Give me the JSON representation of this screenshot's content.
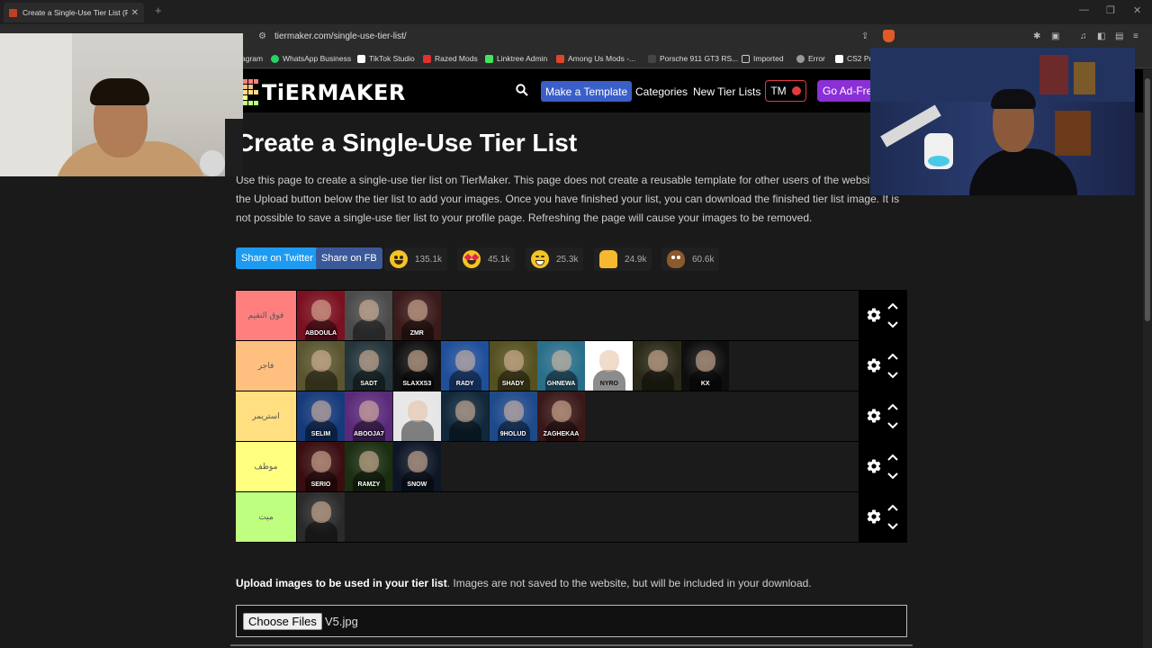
{
  "browser": {
    "tab_title": "Create a Single-Use Tier List (Pr",
    "tab_close": "✕",
    "new_tab": "+",
    "url": "tiermaker.com/single-use-tier-list/",
    "window_controls": [
      "—",
      "❐",
      "✕"
    ],
    "bookmarks": [
      {
        "label": "agram",
        "color": "#c13584"
      },
      {
        "label": "WhatsApp Business",
        "color": "#25d366"
      },
      {
        "label": "TikTok Studio",
        "color": "#ffffff"
      },
      {
        "label": "Razed Mods",
        "color": "#e03030"
      },
      {
        "label": "Linktree Admin",
        "color": "#43e55e"
      },
      {
        "label": "Among Us Mods -...",
        "color": "#e0452a"
      },
      {
        "label": "Porsche 911 GT3 RS...",
        "color": "#444444"
      },
      {
        "label": "Imported",
        "color": "#cccccc"
      },
      {
        "label": "Error",
        "color": "#999999"
      },
      {
        "label": "CS2 Pr",
        "color": "#ffffff"
      }
    ]
  },
  "nav": {
    "logo": "TiERMAKER",
    "make_template": "Make a Template",
    "categories": "Categories",
    "new_tier_lists": "New Tier Lists",
    "tm": "TM",
    "ad_free": "Go Ad-Free"
  },
  "page": {
    "title": "Create a Single-Use Tier List",
    "intro": "Use this page to create a single-use tier list on TierMaker. This page does not create a reusable template for other users of the website. Use the Upload button below the tier list to add your images. Once you have finished your list, you can download the finished tier list image. It is not possible to save a single-use tier list to your profile page. Refreshing the page will cause your images to be removed.",
    "share_twitter": "Share on Twitter",
    "share_fb": "Share on FB",
    "reactions": [
      {
        "icon": "smile-emoji-icon",
        "count": "135.1k"
      },
      {
        "icon": "heart-eyes-emoji-icon",
        "count": "45.1k"
      },
      {
        "icon": "laugh-emoji-icon",
        "count": "25.3k"
      },
      {
        "icon": "raised-hands-emoji-icon",
        "count": "24.9k"
      },
      {
        "icon": "poop-emoji-icon",
        "count": "60.6k"
      }
    ],
    "upload_bold": "Upload images to be used in your tier list",
    "upload_rest": ". Images are not saved to the website, but will be included in your download.",
    "choose_files": "Choose Files",
    "file_name": "V5.jpg"
  },
  "tiers": [
    {
      "label": "فوق التقيم",
      "color": "#ff7f7f",
      "items": [
        {
          "bg": "#7a1020",
          "tag": "ABDOULA"
        },
        {
          "bg": "#4a4a4a",
          "tag": ""
        },
        {
          "bg": "#3a1a1a",
          "tag": "ZMR"
        }
      ]
    },
    {
      "label": "فاجر",
      "color": "#ffbf7f",
      "items": [
        {
          "bg": "#5a5530",
          "tag": ""
        },
        {
          "bg": "#23343a",
          "tag": "SADT"
        },
        {
          "bg": "#101010",
          "tag": "SLAXXS3"
        },
        {
          "bg": "#1f4f9a",
          "tag": "RADY"
        },
        {
          "bg": "#55501f",
          "tag": "SHADY"
        },
        {
          "bg": "#2a6f8a",
          "tag": "GHNEWA"
        },
        {
          "bg": "#ffffff",
          "tag": "NYRO"
        },
        {
          "bg": "#2a2818",
          "tag": ""
        },
        {
          "bg": "#0e0e0e",
          "tag": "KX"
        }
      ]
    },
    {
      "label": "استريمر",
      "color": "#ffdf7f",
      "items": [
        {
          "bg": "#153a7a",
          "tag": "SELIM"
        },
        {
          "bg": "#5a2a7a",
          "tag": "ABOOJA7"
        },
        {
          "bg": "#e6e6e6",
          "tag": ""
        },
        {
          "bg": "#10283a",
          "tag": ""
        },
        {
          "bg": "#1e4a8a",
          "tag": "9HOLUD"
        },
        {
          "bg": "#3a1818",
          "tag": "ZAGHEKAA"
        }
      ]
    },
    {
      "label": "موظف",
      "color": "#ffff7f",
      "items": [
        {
          "bg": "#3a0e10",
          "tag": "SERIO"
        },
        {
          "bg": "#1a2e12",
          "tag": "RAMZY"
        },
        {
          "bg": "#0e1626",
          "tag": "SNOW"
        }
      ]
    },
    {
      "label": "ميت",
      "color": "#bfff7f",
      "items": [
        {
          "bg": "#2a2a2a",
          "tag": ""
        }
      ]
    }
  ]
}
